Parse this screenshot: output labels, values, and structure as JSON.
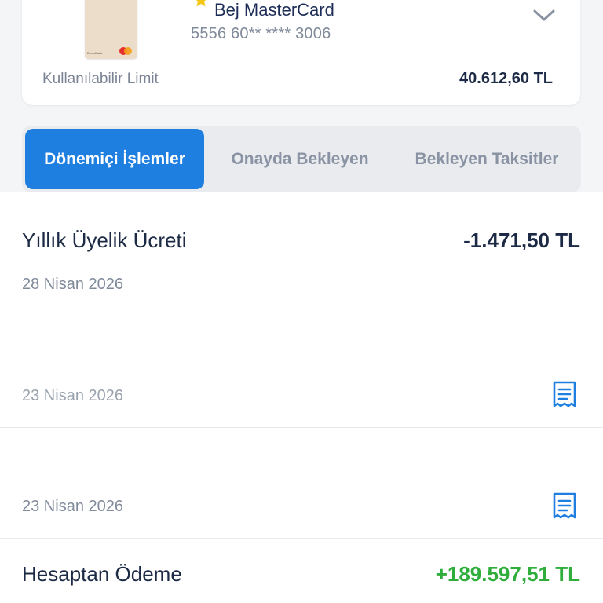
{
  "card": {
    "name": "Bej MasterCard",
    "number": "5556 60** **** 3006",
    "brand_mark": "DenizBank",
    "limit_label": "Kullanılabilir Limit",
    "limit_value": "40.612,60 TL",
    "star_color": "#f3c612",
    "card_color": "#ecdcca"
  },
  "tabs": [
    {
      "label": "Dönemiçi İşlemler",
      "active": true
    },
    {
      "label": "Onayda Bekleyen",
      "active": false
    },
    {
      "label": "Bekleyen Taksitler",
      "active": false
    }
  ],
  "accent_color": "#1e7fe0",
  "positive_color": "#2fae3c",
  "transactions": [
    {
      "title": "Yıllık Üyelik Ücreti",
      "amount": "-1.471,50 TL",
      "date": "28 Nisan 2026",
      "icon": ""
    },
    {
      "title": "",
      "amount": "",
      "date": "23 Nisan 2026",
      "icon": "receipt-icon"
    },
    {
      "title": "",
      "amount": "",
      "date": "23 Nisan 2026",
      "icon": "receipt-icon"
    },
    {
      "title": "Hesaptan Ödeme",
      "amount": "+189.597,51 TL",
      "date": "",
      "icon": ""
    }
  ]
}
